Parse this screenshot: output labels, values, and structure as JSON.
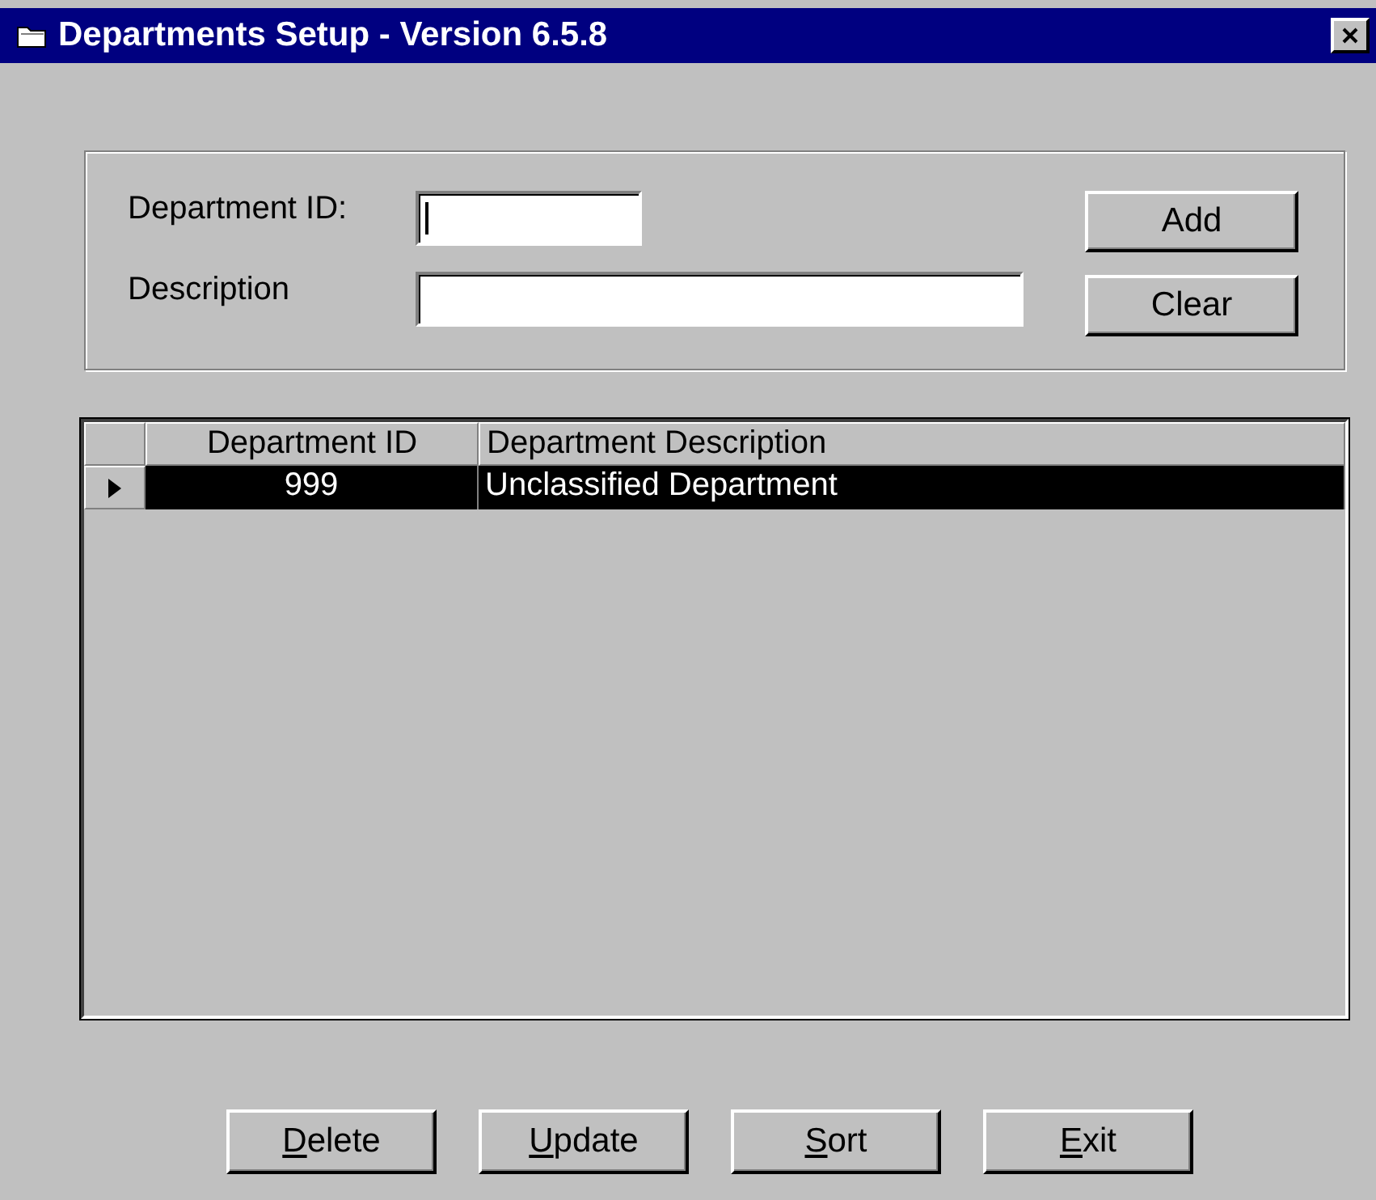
{
  "window": {
    "title": "Departments Setup - Version 6.5.8"
  },
  "form": {
    "fields": [
      {
        "label": "Department ID:",
        "kind": "short",
        "focused": true
      },
      {
        "label": "Description",
        "kind": "long",
        "focused": false
      }
    ],
    "buttons": [
      "Add",
      "Clear"
    ]
  },
  "table": {
    "columns": [
      "Department ID",
      "Department Description"
    ],
    "rows": [
      {
        "cells": [
          "999",
          "Unclassified Department"
        ],
        "selected": true
      }
    ]
  },
  "buttons": [
    {
      "mnemonic": "D",
      "rest": "elete"
    },
    {
      "mnemonic": "U",
      "rest": "pdate"
    },
    {
      "mnemonic": "S",
      "rest": "ort"
    },
    {
      "mnemonic": "E",
      "rest": "xit"
    }
  ]
}
